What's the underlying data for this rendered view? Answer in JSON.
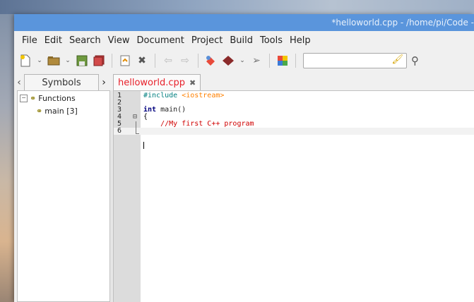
{
  "window": {
    "title": "*helloworld.cpp - /home/pi/Code -"
  },
  "menu": [
    "File",
    "Edit",
    "Search",
    "View",
    "Document",
    "Project",
    "Build",
    "Tools",
    "Help"
  ],
  "toolbar": {
    "icons": [
      "new-file-icon",
      "open-file-icon",
      "save-icon",
      "save-all-icon",
      "revert-icon",
      "close-icon",
      "back-icon",
      "forward-icon",
      "compile-icon",
      "build-icon",
      "send-icon",
      "color-chooser-icon"
    ],
    "search_value": ""
  },
  "sidebar": {
    "tab_label": "Symbols",
    "tree": {
      "group_label": "Functions",
      "expander": "−",
      "items": [
        {
          "label": "main [3]"
        }
      ]
    }
  },
  "editor": {
    "tab_label": "helloworld.cpp",
    "tab_close": "✖",
    "lines": [
      {
        "n": "1",
        "text": "#include <iostream>"
      },
      {
        "n": "2",
        "text": ""
      },
      {
        "n": "3",
        "text": "int main()"
      },
      {
        "n": "4",
        "text": "{"
      },
      {
        "n": "5",
        "text": "    //My first C++ program"
      },
      {
        "n": "6",
        "text": ""
      }
    ]
  },
  "colors": {
    "titlebar": "#5a95dc",
    "tab_text": "#e8212b",
    "keyword": "#00007f",
    "include": "#007f7f",
    "string": "#ff8000",
    "comment": "#d00000"
  }
}
